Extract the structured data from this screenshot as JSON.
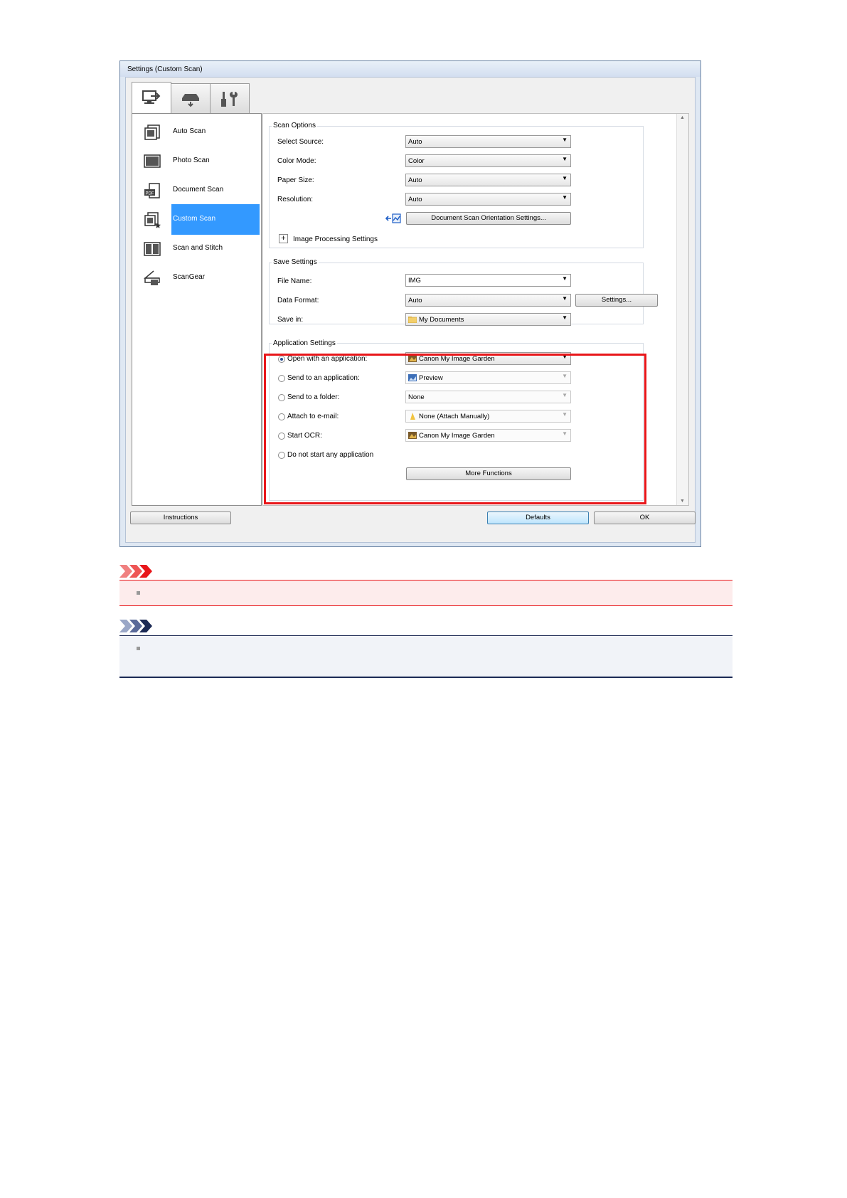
{
  "dialog": {
    "title": "Settings (Custom Scan)",
    "tabs": [
      "scan-from-computer-icon",
      "scan-from-operation-panel-icon",
      "general-settings-icon"
    ]
  },
  "sidebar": {
    "items": [
      {
        "label": "Auto Scan",
        "icon": "auto-scan-icon"
      },
      {
        "label": "Photo Scan",
        "icon": "photo-scan-icon"
      },
      {
        "label": "Document Scan",
        "icon": "document-scan-icon"
      },
      {
        "label": "Custom Scan",
        "icon": "custom-scan-icon",
        "selected": true
      },
      {
        "label": "Scan and Stitch",
        "icon": "scan-and-stitch-icon"
      },
      {
        "label": "ScanGear",
        "icon": "scangear-icon"
      }
    ]
  },
  "scan_options": {
    "title": "Scan Options",
    "select_source_label": "Select Source:",
    "select_source_value": "Auto",
    "color_mode_label": "Color Mode:",
    "color_mode_value": "Color",
    "paper_size_label": "Paper Size:",
    "paper_size_value": "Auto",
    "resolution_label": "Resolution:",
    "resolution_value": "Auto",
    "orientation_button": "Document Scan Orientation Settings...",
    "image_processing_label": "Image Processing Settings",
    "expand_symbol": "+"
  },
  "save_settings": {
    "title": "Save Settings",
    "file_name_label": "File Name:",
    "file_name_value": "IMG",
    "data_format_label": "Data Format:",
    "data_format_value": "Auto",
    "settings_button": "Settings...",
    "save_in_label": "Save in:",
    "save_in_value": "My Documents"
  },
  "application_settings": {
    "title": "Application Settings",
    "open_with_label": "Open with an application:",
    "open_with_value": "Canon My Image Garden",
    "send_to_app_label": "Send to an application:",
    "send_to_app_value": "Preview",
    "send_to_folder_label": "Send to a folder:",
    "send_to_folder_value": "None",
    "attach_email_label": "Attach to e-mail:",
    "attach_email_value": "None (Attach Manually)",
    "start_ocr_label": "Start OCR:",
    "start_ocr_value": "Canon My Image Garden",
    "do_not_start_label": "Do not start any application",
    "more_functions_button": "More Functions",
    "selected_option": "open_with"
  },
  "footer": {
    "instructions_button": "Instructions",
    "defaults_button": "Defaults",
    "ok_button": "OK"
  },
  "colors": {
    "highlight": "#e8161a",
    "selection": "#3399ff",
    "important": "#e8161a",
    "note": "#1c2a55"
  }
}
